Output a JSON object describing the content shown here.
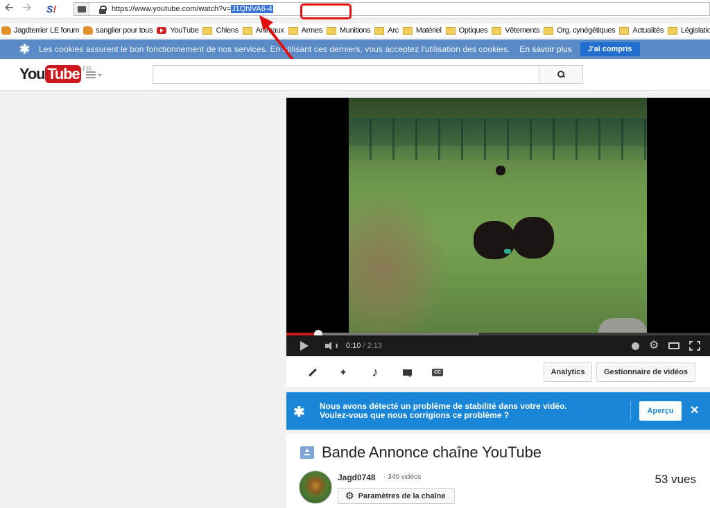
{
  "browser": {
    "url_prefix": "https://www.youtube.com/watch?v=",
    "url_selected": "J1QhlVA6-4",
    "bookmarks": [
      {
        "icon": "favicon",
        "label": "Jagdterrier LE forum"
      },
      {
        "icon": "favicon",
        "label": "sanglier pour tous"
      },
      {
        "icon": "youtube",
        "label": "YouTube"
      },
      {
        "icon": "folder",
        "label": "Chiens"
      },
      {
        "icon": "folder",
        "label": "Animaux"
      },
      {
        "icon": "folder",
        "label": "Armes"
      },
      {
        "icon": "folder",
        "label": "Munitions"
      },
      {
        "icon": "folder",
        "label": "Arc"
      },
      {
        "icon": "folder",
        "label": "Matériel"
      },
      {
        "icon": "folder",
        "label": "Optiques"
      },
      {
        "icon": "folder",
        "label": "Vêtements"
      },
      {
        "icon": "folder",
        "label": "Org. cynégétiques"
      },
      {
        "icon": "folder",
        "label": "Actualités"
      },
      {
        "icon": "folder",
        "label": "Législation"
      }
    ]
  },
  "cookie_bar": {
    "text": "Les cookies assurent le bon fonctionnement de nos services. En utilisant ces derniers, vous acceptez l'utilisation des cookies.",
    "learn_more": "En savoir plus",
    "accept": "J'ai compris"
  },
  "header": {
    "logo_you": "You",
    "logo_tube": "Tube",
    "logo_region": "FR",
    "search_placeholder": ""
  },
  "player": {
    "current_time": "0:10",
    "duration": "/ 2:13",
    "progress_played": 0.075,
    "progress_loaded": 0.455
  },
  "toolbar": {
    "analytics": "Analytics",
    "video_manager": "Gestionnaire de vidéos"
  },
  "stability_notice": {
    "line1": "Nous avons détecté un problème de stabilité dans votre vidéo.",
    "line2": "Voulez-vous que nous corrigions ce problème ?",
    "preview": "Aperçu"
  },
  "video": {
    "title": "Bande Annonce chaîne YouTube",
    "channel": "Jagd0748",
    "video_count": "· 340 vidéos",
    "channel_settings": "Paramètres de la chaîne",
    "views": "53 vues"
  },
  "colors": {
    "brand_red": "#cc181e",
    "cookie_bar": "#5a8bc6",
    "notice_blue": "#1a86d8",
    "annotation_red": "#e01010"
  }
}
